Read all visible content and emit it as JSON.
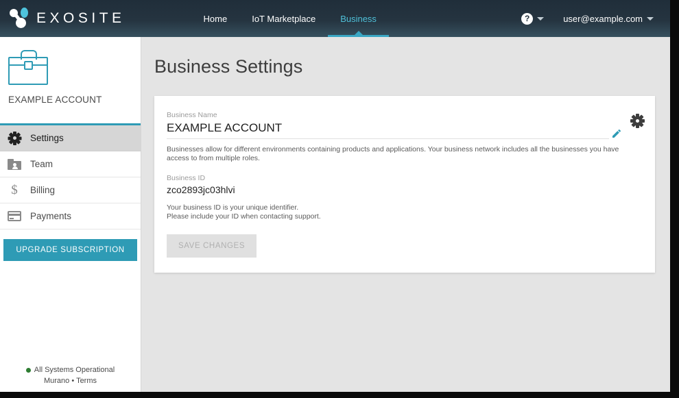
{
  "brand": {
    "name": "EXOSITE",
    "logo_icon": "exosite-node-logo-icon",
    "accent_teal": "#2e9bb5",
    "accent_light_teal": "#4fc0d8",
    "header_bg": "#202e3a"
  },
  "topnav": {
    "links": [
      {
        "label": "Home",
        "active": false
      },
      {
        "label": "IoT Marketplace",
        "active": false
      },
      {
        "label": "Business",
        "active": true
      }
    ],
    "help_icon": "help-circle-icon",
    "help_glyph": "?",
    "help_caret_icon": "chevron-down-icon",
    "user_email": "user@example.com",
    "user_caret_icon": "chevron-down-icon"
  },
  "sidebar": {
    "account_icon": "briefcase-icon",
    "account_name": "EXAMPLE ACCOUNT",
    "items": [
      {
        "label": "Settings",
        "icon": "gear-icon",
        "active": true
      },
      {
        "label": "Team",
        "icon": "folder-person-icon",
        "active": false
      },
      {
        "label": "Billing",
        "icon": "dollar-sign-icon",
        "active": false
      },
      {
        "label": "Payments",
        "icon": "credit-card-icon",
        "active": false
      }
    ],
    "upgrade_label": "UPGRADE SUBSCRIPTION",
    "status": {
      "dot_icon": "status-dot-icon",
      "dot_color": "#2e7d32",
      "text": "All Systems Operational"
    },
    "footer_links": [
      {
        "label": "Murano"
      },
      {
        "label": "Terms"
      }
    ],
    "footer_separator": "•"
  },
  "main": {
    "page_title": "Business Settings",
    "card": {
      "gear_icon": "gear-icon",
      "edit_icon": "pencil-edit-icon",
      "business_name_label": "Business Name",
      "business_name_value": "EXAMPLE ACCOUNT",
      "business_name_description": "Businesses allow for different environments containing products and applications.  Your business network includes all the businesses you have access to from multiple roles.",
      "business_id_label": "Business ID",
      "business_id_value": "zco2893jc03hlvi",
      "business_id_description_line1": "Your business ID is your unique identifier.",
      "business_id_description_line2": "Please include your ID when contacting support.",
      "save_label": "SAVE CHANGES"
    }
  }
}
